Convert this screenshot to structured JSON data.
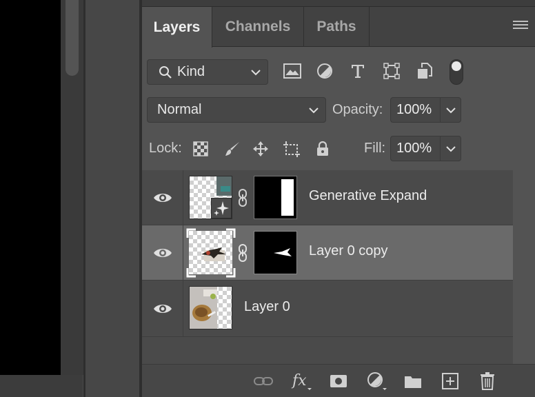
{
  "tabs": [
    {
      "label": "Layers",
      "active": true
    },
    {
      "label": "Channels",
      "active": false
    },
    {
      "label": "Paths",
      "active": false
    }
  ],
  "filter": {
    "kind_label": "Kind",
    "icons": [
      "image-filter-icon",
      "adjustment-filter-icon",
      "type-filter-icon",
      "shape-filter-icon",
      "smart-object-filter-icon"
    ],
    "toggle_on": true
  },
  "blend": {
    "mode": "Normal",
    "opacity_label": "Opacity:",
    "opacity_value": "100%"
  },
  "lock": {
    "label": "Lock:",
    "icons": [
      "lock-transparent-pixels-icon",
      "lock-image-pixels-icon",
      "lock-position-icon",
      "lock-artboard-icon",
      "lock-all-icon"
    ],
    "fill_label": "Fill:",
    "fill_value": "100%"
  },
  "layers": [
    {
      "name": "Generative Expand",
      "visible": true,
      "selected": false,
      "has_mask": true
    },
    {
      "name": "Layer 0 copy",
      "visible": true,
      "selected": true,
      "has_mask": true
    },
    {
      "name": "Layer 0",
      "visible": true,
      "selected": false,
      "has_mask": false
    }
  ],
  "bottom_icons": [
    "link-layers-icon",
    "fx-icon",
    "add-mask-icon",
    "adjustment-layer-icon",
    "new-group-icon",
    "new-layer-icon",
    "delete-icon"
  ],
  "colors": {
    "panel_bg": "#535353",
    "selected_row": "#6a6a6a",
    "text": "#ececec"
  }
}
